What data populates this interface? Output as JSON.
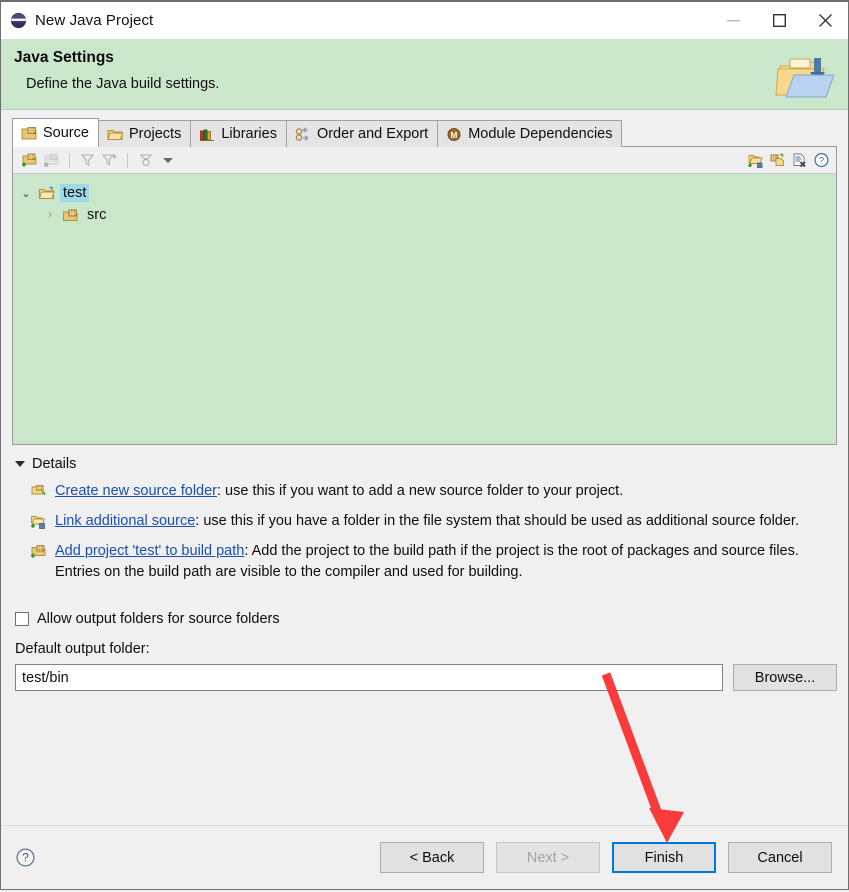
{
  "window": {
    "title": "New Java Project",
    "app_icon": "eclipse-icon",
    "controls": {
      "minimize": "—",
      "maximize": "▢",
      "close": "✕"
    }
  },
  "banner": {
    "title": "Java Settings",
    "subtitle": "Define the Java build settings.",
    "icon": "java-settings-folder-icon",
    "background": "#cbe7cb"
  },
  "tabs": [
    {
      "label": "Source",
      "icon": "source-folder-icon",
      "active": true
    },
    {
      "label": "Projects",
      "icon": "projects-folder-icon",
      "active": false
    },
    {
      "label": "Libraries",
      "icon": "libraries-books-icon",
      "active": false
    },
    {
      "label": "Order and Export",
      "icon": "order-export-icon",
      "active": false
    },
    {
      "label": "Module Dependencies",
      "icon": "module-dependencies-icon",
      "active": false
    }
  ],
  "panel": {
    "toolbar_left": [
      "add-source-folder-icon",
      "remove-source-folder-icon",
      "filter-icon",
      "add-filter-icon",
      "sort-icon"
    ],
    "toolbar_right": [
      "create-new-source-folder-icon",
      "link-additional-source-icon",
      "remove-entry-icon",
      "help-icon"
    ],
    "tree": [
      {
        "label": "test",
        "icon": "project-folder-icon",
        "selected": true,
        "expanded": true,
        "indent": 0
      },
      {
        "label": "src",
        "icon": "source-package-icon",
        "selected": false,
        "expanded": false,
        "indent": 1
      }
    ]
  },
  "details": {
    "header": "Details",
    "items": [
      {
        "icon": "create-new-source-folder-icon",
        "link": "Create new source folder",
        "text": ": use this if you want to add a new source folder to your project."
      },
      {
        "icon": "link-additional-source-icon",
        "link": "Link additional source",
        "text": ": use this if you have a folder in the file system that should be used as additional source folder."
      },
      {
        "icon": "add-project-build-path-icon",
        "link": "Add project 'test' to build path",
        "text": ": Add the project to the build path if the project is the root of packages and source files. Entries on the build path are visible to the compiler and used for building."
      }
    ]
  },
  "form": {
    "allow_output_folders_label": "Allow output folders for source folders",
    "allow_output_folders_checked": false,
    "default_output_label": "Default output folder:",
    "default_output_value": "test/bin",
    "browse_label": "Browse..."
  },
  "footer": {
    "help_icon": "help-icon",
    "buttons": [
      {
        "label": "< Back",
        "state": "enabled"
      },
      {
        "label": "Next >",
        "state": "disabled"
      },
      {
        "label": "Finish",
        "state": "focused"
      },
      {
        "label": "Cancel",
        "state": "enabled"
      }
    ]
  },
  "annotation": {
    "arrow_color": "#fb3b3b",
    "target": "Finish"
  }
}
